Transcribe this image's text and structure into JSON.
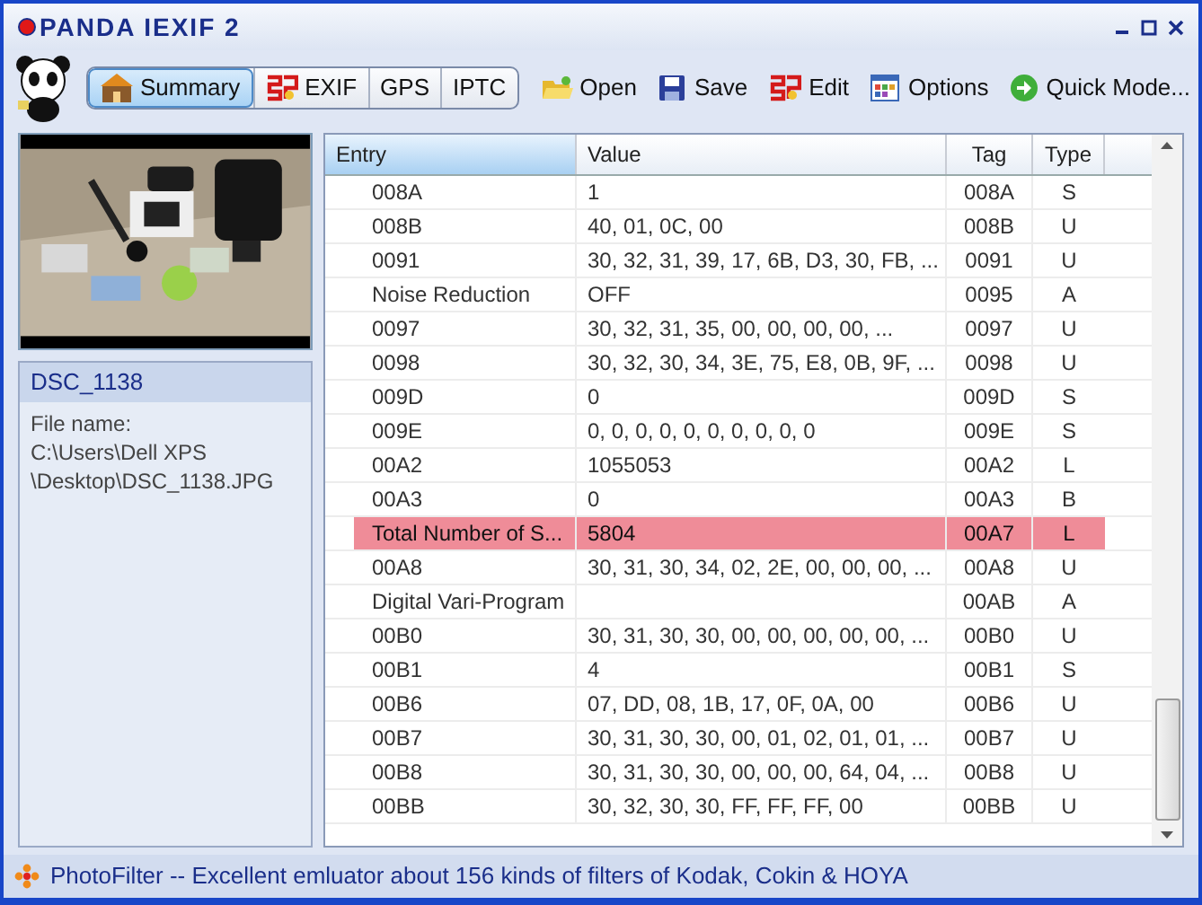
{
  "window": {
    "title": "PANDA IEXIF 2"
  },
  "tabs": [
    {
      "label": "Summary",
      "selected": true
    },
    {
      "label": "EXIF",
      "selected": false
    },
    {
      "label": "GPS",
      "selected": false
    },
    {
      "label": "IPTC",
      "selected": false
    }
  ],
  "toolbar": [
    {
      "label": "Open"
    },
    {
      "label": "Save"
    },
    {
      "label": "Edit"
    },
    {
      "label": "Options"
    },
    {
      "label": "Quick Mode..."
    }
  ],
  "file_info": {
    "name": "DSC_1138",
    "lines": [
      "File name:",
      "C:\\Users\\Dell XPS",
      "\\Desktop\\DSC_1138.JPG"
    ]
  },
  "table": {
    "columns": [
      "Entry",
      "Value",
      "Tag",
      "Type"
    ],
    "rows": [
      {
        "entry": "008A",
        "value": "1",
        "tag": "008A",
        "type": "S",
        "selected": false
      },
      {
        "entry": "008B",
        "value": "40, 01, 0C, 00",
        "tag": "008B",
        "type": "U",
        "selected": false
      },
      {
        "entry": "0091",
        "value": "30, 32, 31, 39, 17, 6B, D3, 30, FB, ...",
        "tag": "0091",
        "type": "U",
        "selected": false
      },
      {
        "entry": "Noise Reduction",
        "value": "OFF",
        "tag": "0095",
        "type": "A",
        "selected": false
      },
      {
        "entry": "0097",
        "value": "30, 32, 31, 35, 00, 00, 00, 00, ...",
        "tag": "0097",
        "type": "U",
        "selected": false
      },
      {
        "entry": "0098",
        "value": "30, 32, 30, 34, 3E, 75, E8, 0B, 9F, ...",
        "tag": "0098",
        "type": "U",
        "selected": false
      },
      {
        "entry": "009D",
        "value": "0",
        "tag": "009D",
        "type": "S",
        "selected": false
      },
      {
        "entry": "009E",
        "value": "0, 0, 0, 0, 0, 0, 0, 0, 0, 0",
        "tag": "009E",
        "type": "S",
        "selected": false
      },
      {
        "entry": "00A2",
        "value": "1055053",
        "tag": "00A2",
        "type": "L",
        "selected": false
      },
      {
        "entry": "00A3",
        "value": "0",
        "tag": "00A3",
        "type": "B",
        "selected": false
      },
      {
        "entry": "Total Number of S...",
        "value": "5804",
        "tag": "00A7",
        "type": "L",
        "selected": true
      },
      {
        "entry": "00A8",
        "value": "30, 31, 30, 34, 02, 2E, 00, 00, 00, ...",
        "tag": "00A8",
        "type": "U",
        "selected": false
      },
      {
        "entry": "Digital Vari-Program",
        "tag": "00AB",
        "type": "A",
        "selected": false
      },
      {
        "entry": "00B0",
        "value": "30, 31, 30, 30, 00, 00, 00, 00, 00, ...",
        "tag": "00B0",
        "type": "U",
        "selected": false
      },
      {
        "entry": "00B1",
        "value": "4",
        "tag": "00B1",
        "type": "S",
        "selected": false
      },
      {
        "entry": "00B6",
        "value": "07, DD, 08, 1B, 17, 0F, 0A, 00",
        "tag": "00B6",
        "type": "U",
        "selected": false
      },
      {
        "entry": "00B7",
        "value": "30, 31, 30, 30, 00, 01, 02, 01, 01, ...",
        "tag": "00B7",
        "type": "U",
        "selected": false
      },
      {
        "entry": "00B8",
        "value": "30, 31, 30, 30, 00, 00, 00, 64, 04, ...",
        "tag": "00B8",
        "type": "U",
        "selected": false
      },
      {
        "entry": "00BB",
        "value": "30, 32, 30, 30, FF, FF, FF, 00",
        "tag": "00BB",
        "type": "U",
        "selected": false
      }
    ]
  },
  "status_bar": "PhotoFilter -- Excellent emluator about 156 kinds of filters of Kodak, Cokin & HOYA"
}
